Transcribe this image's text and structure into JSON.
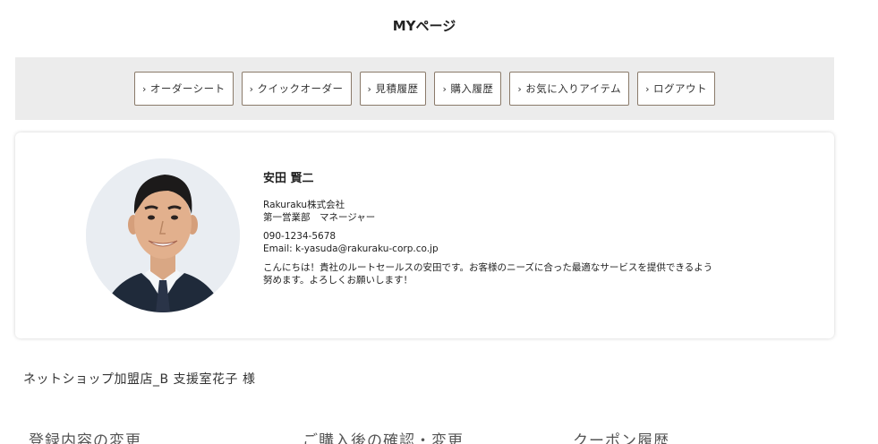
{
  "page": {
    "title": "MYページ"
  },
  "nav": {
    "items": [
      {
        "id": "order-sheet",
        "label": "オーダーシート"
      },
      {
        "id": "quick-order",
        "label": "クイックオーダー"
      },
      {
        "id": "estimate-history",
        "label": "見積履歴"
      },
      {
        "id": "purchase-history",
        "label": "購入履歴"
      },
      {
        "id": "favorites",
        "label": "お気に入りアイテム"
      },
      {
        "id": "logout",
        "label": "ログアウト"
      }
    ],
    "chevron": "›"
  },
  "profile": {
    "name": "安田 賢二",
    "company": "Rakuraku株式会社",
    "department": "第一営業部　マネージャー",
    "phone": "090-1234-5678",
    "email": "Email: k-yasuda@rakuraku-corp.co.jp",
    "message_line1": "こんにちは！貴社のルートセールスの安田です。お客様のニーズに合った最適なサービスを提供できるよう",
    "message_line2": "努めます。よろしくお願いします！"
  },
  "user": {
    "greeting": "ネットショップ加盟店_B 支援室花子 様"
  },
  "sections": {
    "registration": "登録内容の変更",
    "post_purchase": "ご購入後の確認・変更",
    "coupon": "クーポン履歴"
  },
  "colors": {
    "nav_bg": "#ececec",
    "button_border": "#8a7a6a"
  }
}
